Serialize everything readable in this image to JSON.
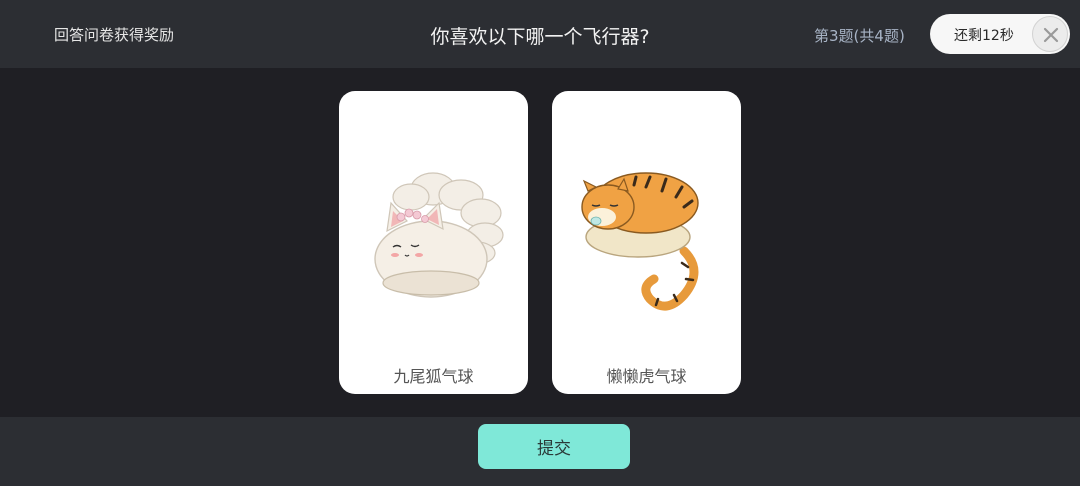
{
  "header": {
    "reward_text": "回答问卷获得奖励",
    "question": "你喜欢以下哪一个飞行器?",
    "question_number": "第3题(共4题)",
    "timer": "还剩12秒",
    "close_icon": "close-icon"
  },
  "options": [
    {
      "label": "九尾狐气球",
      "image": "nine-tailed-fox-balloon"
    },
    {
      "label": "懒懒虎气球",
      "image": "lazy-tiger-balloon"
    }
  ],
  "footer": {
    "submit_label": "提交"
  },
  "colors": {
    "background": "#1f1f24",
    "bar": "#2c2e33",
    "accent": "#7fe8d8",
    "card": "#ffffff"
  }
}
